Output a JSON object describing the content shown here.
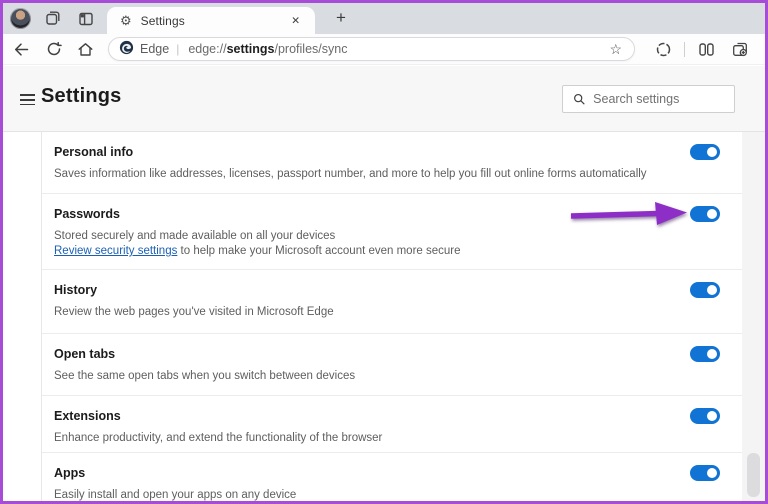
{
  "window": {
    "border_color": "#a64cd6"
  },
  "tab_bar": {
    "tab_title": "Settings",
    "icons": {
      "gear": "⚙",
      "close": "✕",
      "new_tab": "+"
    }
  },
  "toolbar": {
    "edge_label": "Edge",
    "pipe": "|",
    "url": {
      "prefix": "edge://",
      "bold": "settings",
      "suffix": "/profiles/sync"
    },
    "icons": {
      "favorites_star": "☆"
    }
  },
  "settings_header": {
    "title": "Settings",
    "search_placeholder": "Search settings"
  },
  "accent": {
    "toggle_on": "#1173d4",
    "link": "#1b60b5",
    "arrow": "#8d2ec6"
  },
  "rows": [
    {
      "title": "Personal info",
      "description": "Saves information like addresses, licenses, passport number, and more to help you fill out online forms automatically",
      "toggle_on": true
    },
    {
      "title": "Passwords",
      "description": "Stored securely and made available on all your devices",
      "link_text": "Review security settings",
      "description2": " to help make your Microsoft account even more secure",
      "toggle_on": true,
      "annotated": true
    },
    {
      "title": "History",
      "description": "Review the web pages you've visited in Microsoft Edge",
      "toggle_on": true
    },
    {
      "title": "Open tabs",
      "description": "See the same open tabs when you switch between devices",
      "toggle_on": true
    },
    {
      "title": "Extensions",
      "description": "Enhance productivity, and extend the functionality of the browser",
      "toggle_on": true
    },
    {
      "title": "Apps",
      "description": "Easily install and open your apps on any device",
      "toggle_on": true
    }
  ]
}
